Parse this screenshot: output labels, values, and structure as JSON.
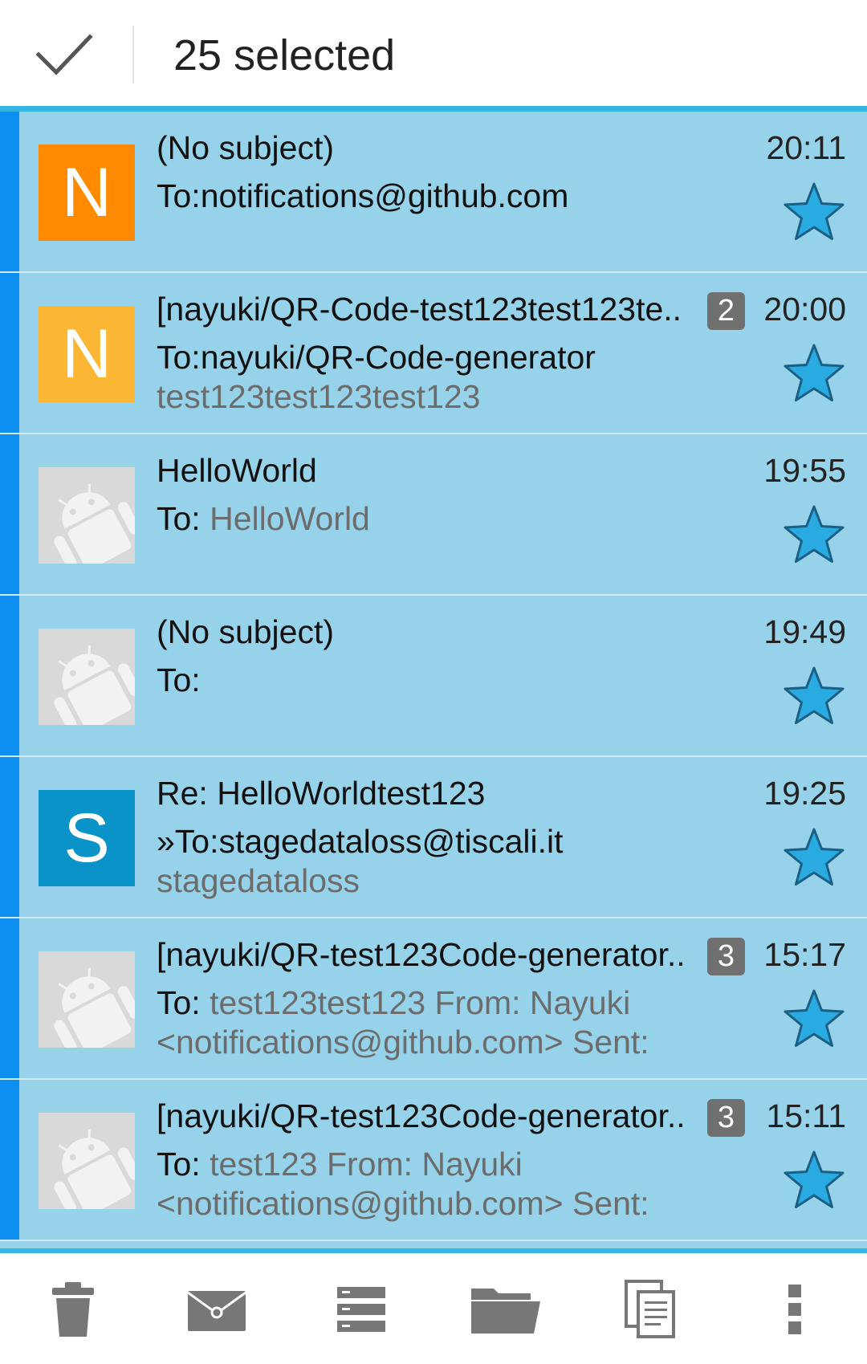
{
  "action_bar": {
    "selected_label": "25 selected",
    "done_icon": "checkmark-icon"
  },
  "colors": {
    "selection_bar": "#0d8ff2",
    "row_selected_bg": "#96d3ea",
    "accent": "#33b5e5",
    "star": "#29abe2",
    "badge": "#707070"
  },
  "messages": [
    {
      "avatar_letter": "N",
      "avatar_color": "#ff8a00",
      "subject": "(No subject)",
      "to_label": "To:",
      "to_value": "notifications@github.com",
      "preview": "",
      "count": "",
      "time": "20:11",
      "starred": true
    },
    {
      "avatar_letter": "N",
      "avatar_color": "#fbb634",
      "subject": "[nayuki/QR-Code-test123test123te..",
      "to_label": "To:",
      "to_value": "nayuki/QR-Code-generator",
      "preview": "test123test123test123",
      "count": "2",
      "time": "20:00",
      "starred": true
    },
    {
      "avatar_letter": "",
      "avatar_color": "",
      "subject": "HelloWorld",
      "to_label": "To: ",
      "to_value": "HelloWorld",
      "preview": "",
      "count": "",
      "time": "19:55",
      "starred": true
    },
    {
      "avatar_letter": "",
      "avatar_color": "",
      "subject": "(No subject)",
      "to_label": "To:",
      "to_value": "",
      "preview": "",
      "count": "",
      "time": "19:49",
      "starred": true
    },
    {
      "avatar_letter": "S",
      "avatar_color": "#0a93c9",
      "subject": "Re: HelloWorldtest123",
      "to_label": "»To:",
      "to_value": "stagedataloss@tiscali.it",
      "preview": "stagedataloss",
      "count": "",
      "time": "19:25",
      "starred": true
    },
    {
      "avatar_letter": "",
      "avatar_color": "",
      "subject": "[nayuki/QR-test123Code-generator..",
      "to_label": "To: ",
      "to_value": "test123test123 From: Nayuki",
      "preview": "<notifications@github.com> Sent:",
      "count": "3",
      "time": "15:17",
      "starred": true
    },
    {
      "avatar_letter": "",
      "avatar_color": "",
      "subject": "[nayuki/QR-test123Code-generator..",
      "to_label": "To: ",
      "to_value": "test123 From: Nayuki",
      "preview": "<notifications@github.com> Sent:",
      "count": "3",
      "time": "15:11",
      "starred": true
    }
  ],
  "toolbar": [
    {
      "icon": "trash-icon"
    },
    {
      "icon": "envelope-icon"
    },
    {
      "icon": "list-icon"
    },
    {
      "icon": "folder-icon"
    },
    {
      "icon": "copy-icon"
    },
    {
      "icon": "overflow-menu-icon"
    }
  ]
}
